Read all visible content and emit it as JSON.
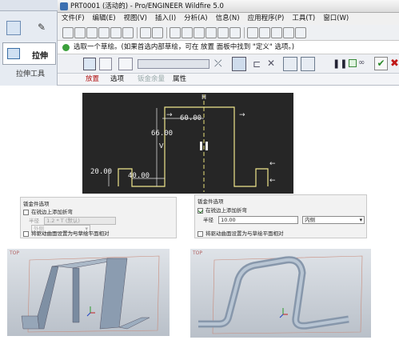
{
  "window": {
    "title": "PRT0001 (活动的) - Pro/ENGINEER Wildfire 5.0"
  },
  "menu": [
    "文件(F)",
    "编辑(E)",
    "视图(V)",
    "插入(I)",
    "分析(A)",
    "信息(N)",
    "应用程序(P)",
    "工具(T)",
    "窗口(W)"
  ],
  "left_panel": {
    "extrude_label": "拉伸",
    "tool_label": "拉伸工具"
  },
  "message": "选取一个草绘。(如果首选内部草绘，可在 放置 面板中找到 \"定义\" 选项。)",
  "dashboard_tabs": [
    "放置",
    "选项",
    "钣金余量",
    "属性"
  ],
  "sketch": {
    "dims": [
      "60.00",
      "66.00",
      "20.00",
      "40.00"
    ],
    "axis_label": "H",
    "side_label": "V"
  },
  "option_left": {
    "title": "钣金件选项",
    "add_bends_label": "在锐边上添加折弯",
    "add_bends_checked": false,
    "radius_label": "半径",
    "radius_value": "1.2 * T (默认)",
    "side_value": "外侧",
    "reference_label": "将驱动曲面设置为与草绘平面相对"
  },
  "option_right": {
    "title": "钣金件选项",
    "add_bends_label": "在锐边上添加折弯",
    "add_bends_checked": true,
    "radius_label": "半径",
    "radius_value": "10.00",
    "side_value": "内侧",
    "reference_label": "将驱动曲面设置为与草绘平面相对"
  },
  "views": {
    "left_label": "TOP",
    "right_label": "TOP"
  },
  "colors": {
    "dashboard_tab_active": "#b01010",
    "sketch_line": "#f0e68c",
    "sketch_bg": "#262626",
    "part_fill": "#8f9fb0"
  }
}
